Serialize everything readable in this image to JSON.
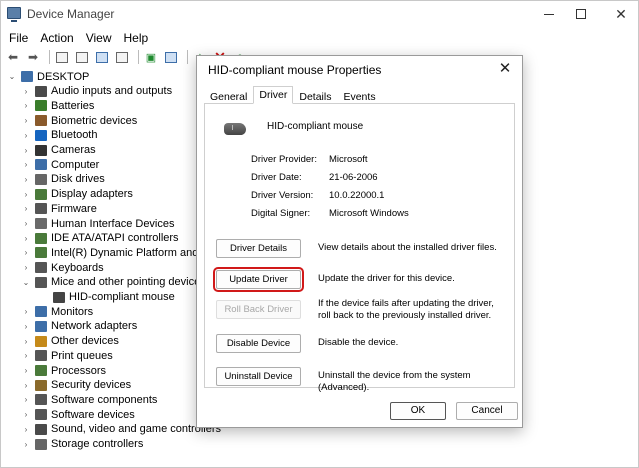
{
  "window": {
    "title": "Device Manager"
  },
  "menu": [
    "File",
    "Action",
    "View",
    "Help"
  ],
  "toolbar": {
    "icons": [
      "back-arrow-icon",
      "forward-arrow-icon",
      "properties-icon",
      "show-hidden-icon",
      "help-icon",
      "scan-hardware-icon",
      "monitor-icon",
      "enable-device-icon",
      "uninstall-x-icon",
      "update-driver-icon"
    ]
  },
  "tree": {
    "root": "DESKTOP",
    "items": [
      {
        "label": "Audio inputs and outputs",
        "expanded": false,
        "icon": "speaker-icon",
        "color": "#4a4a4a"
      },
      {
        "label": "Batteries",
        "expanded": false,
        "icon": "battery-icon",
        "color": "#3a7d2b"
      },
      {
        "label": "Biometric devices",
        "expanded": false,
        "icon": "fingerprint-icon",
        "color": "#8a5a2b"
      },
      {
        "label": "Bluetooth",
        "expanded": false,
        "icon": "bluetooth-icon",
        "color": "#1565c0"
      },
      {
        "label": "Cameras",
        "expanded": false,
        "icon": "camera-icon",
        "color": "#333333"
      },
      {
        "label": "Computer",
        "expanded": false,
        "icon": "computer-icon",
        "color": "#3d6ea8"
      },
      {
        "label": "Disk drives",
        "expanded": false,
        "icon": "disk-icon",
        "color": "#666666"
      },
      {
        "label": "Display adapters",
        "expanded": false,
        "icon": "display-adapter-icon",
        "color": "#4a7a3a"
      },
      {
        "label": "Firmware",
        "expanded": false,
        "icon": "firmware-icon",
        "color": "#555555"
      },
      {
        "label": "Human Interface Devices",
        "expanded": false,
        "icon": "hid-icon",
        "color": "#6a6a6a"
      },
      {
        "label": "IDE ATA/ATAPI controllers",
        "expanded": false,
        "icon": "ide-icon",
        "color": "#4a7a3a"
      },
      {
        "label": "Intel(R) Dynamic Platform and The",
        "expanded": false,
        "icon": "platform-icon",
        "color": "#4a7a3a"
      },
      {
        "label": "Keyboards",
        "expanded": false,
        "icon": "keyboard-icon",
        "color": "#555555"
      },
      {
        "label": "Mice and other pointing devices",
        "expanded": true,
        "icon": "mouse-icon",
        "color": "#555555"
      },
      {
        "label": "HID-compliant mouse",
        "child": true,
        "icon": "mouse-device-icon",
        "color": "#444444"
      },
      {
        "label": "Monitors",
        "expanded": false,
        "icon": "monitor-icon",
        "color": "#3d6ea8"
      },
      {
        "label": "Network adapters",
        "expanded": false,
        "icon": "network-icon",
        "color": "#3d6ea8"
      },
      {
        "label": "Other devices",
        "expanded": false,
        "icon": "other-devices-icon",
        "color": "#c58a1a"
      },
      {
        "label": "Print queues",
        "expanded": false,
        "icon": "printer-icon",
        "color": "#555555"
      },
      {
        "label": "Processors",
        "expanded": false,
        "icon": "processor-icon",
        "color": "#4a7a3a"
      },
      {
        "label": "Security devices",
        "expanded": false,
        "icon": "security-icon",
        "color": "#8a6a2b"
      },
      {
        "label": "Software components",
        "expanded": false,
        "icon": "software-component-icon",
        "color": "#555555"
      },
      {
        "label": "Software devices",
        "expanded": false,
        "icon": "software-device-icon",
        "color": "#555555"
      },
      {
        "label": "Sound, video and game controllers",
        "expanded": false,
        "icon": "sound-icon",
        "color": "#4a4a4a"
      },
      {
        "label": "Storage controllers",
        "expanded": false,
        "icon": "storage-icon",
        "color": "#666666"
      }
    ]
  },
  "dialog": {
    "title": "HID-compliant mouse Properties",
    "tabs": [
      "General",
      "Driver",
      "Details",
      "Events"
    ],
    "active_tab": "Driver",
    "device_name": "HID-compliant mouse",
    "properties": [
      {
        "key": "Driver Provider:",
        "value": "Microsoft"
      },
      {
        "key": "Driver Date:",
        "value": "21-06-2006"
      },
      {
        "key": "Driver Version:",
        "value": "10.0.22000.1"
      },
      {
        "key": "Digital Signer:",
        "value": "Microsoft Windows"
      }
    ],
    "actions": [
      {
        "label": "Driver Details",
        "desc": "View details about the installed driver files."
      },
      {
        "label": "Update Driver",
        "desc": "Update the driver for this device."
      },
      {
        "label": "Roll Back Driver",
        "desc": "If the device fails after updating the driver, roll back to the previously installed driver."
      },
      {
        "label": "Disable Device",
        "desc": "Disable the device."
      },
      {
        "label": "Uninstall Device",
        "desc": "Uninstall the device from the system (Advanced)."
      }
    ],
    "ok": "OK",
    "cancel": "Cancel"
  }
}
